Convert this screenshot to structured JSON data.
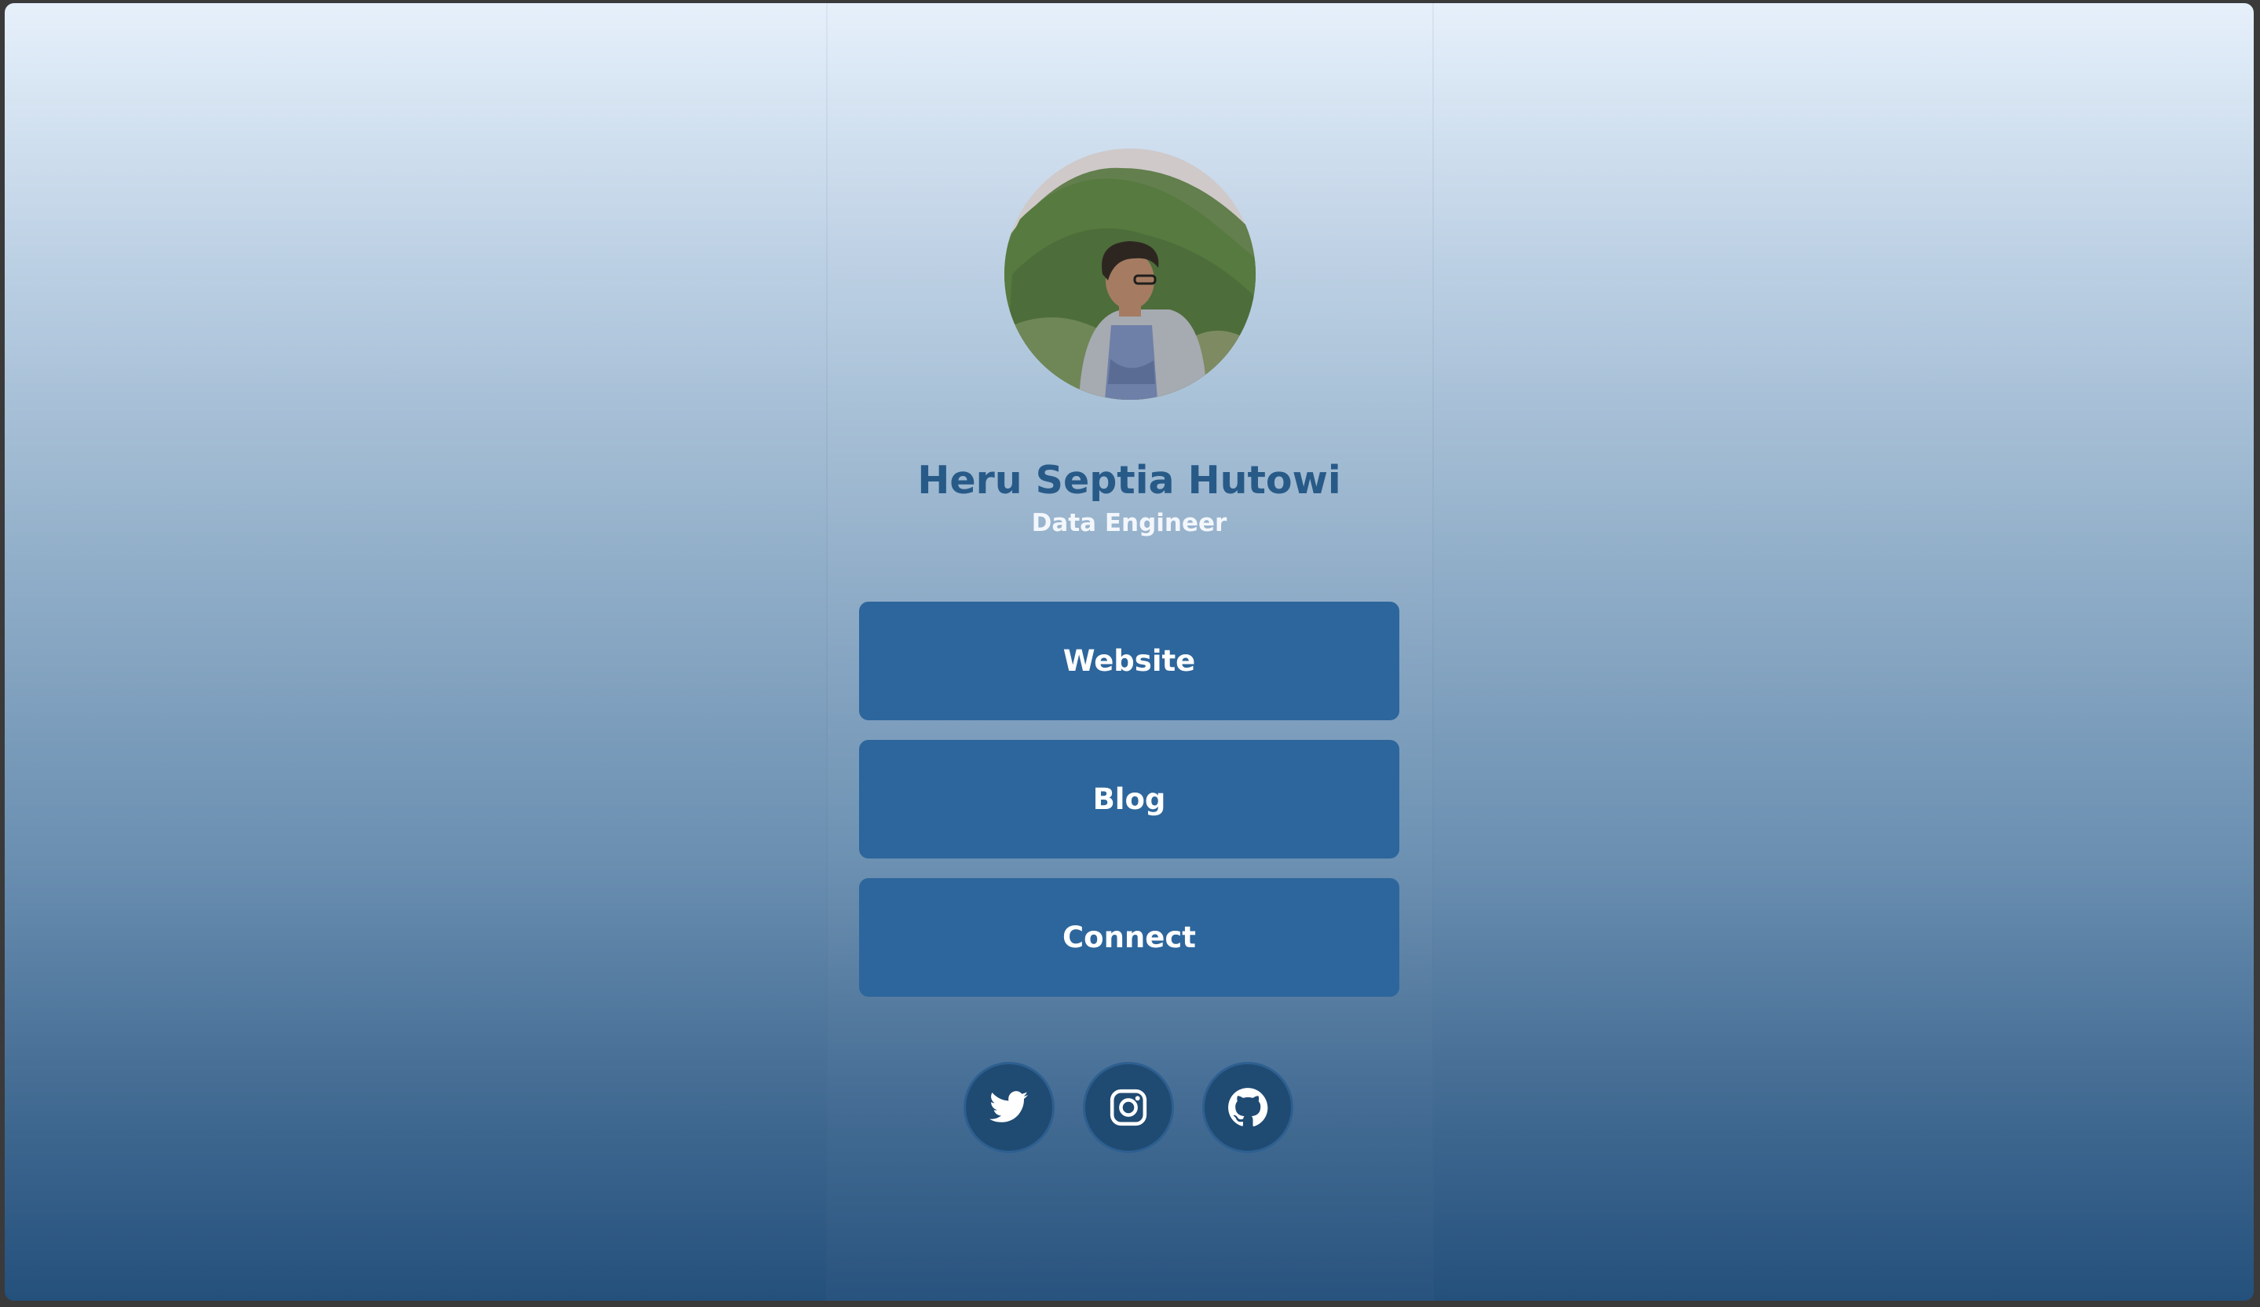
{
  "profile": {
    "name": "Heru Septia Hutowi",
    "role": "Data Engineer",
    "avatar": "profile-photo"
  },
  "links": [
    {
      "label": "Website"
    },
    {
      "label": "Blog"
    },
    {
      "label": "Connect"
    }
  ],
  "social": [
    {
      "icon": "twitter-icon"
    },
    {
      "icon": "instagram-icon"
    },
    {
      "icon": "github-icon"
    }
  ],
  "colors": {
    "background_top": "#e6f0fb",
    "background_bottom": "#24507c",
    "name_text": "#285a88",
    "button": "#2d669c",
    "social_button": "#1f4a72"
  }
}
